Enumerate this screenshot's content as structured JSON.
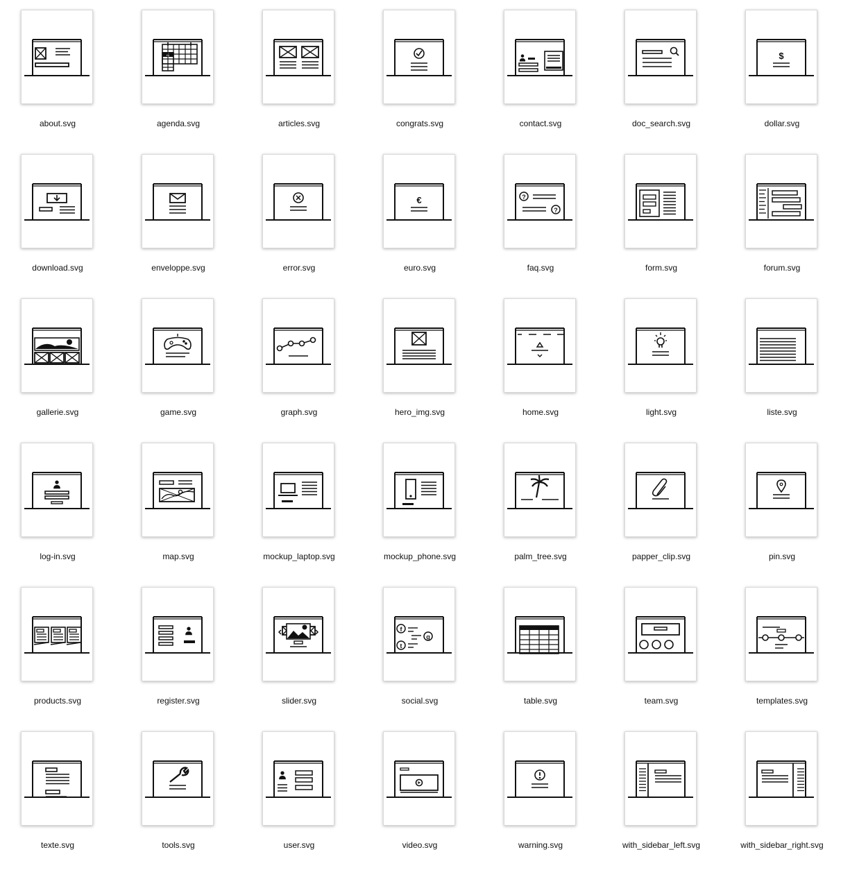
{
  "files": [
    {
      "name": "about.svg",
      "icon": "about-icon"
    },
    {
      "name": "agenda.svg",
      "icon": "agenda-icon"
    },
    {
      "name": "articles.svg",
      "icon": "articles-icon"
    },
    {
      "name": "congrats.svg",
      "icon": "congrats-icon"
    },
    {
      "name": "contact.svg",
      "icon": "contact-icon"
    },
    {
      "name": "doc_search.svg",
      "icon": "doc-search-icon"
    },
    {
      "name": "dollar.svg",
      "icon": "dollar-icon"
    },
    {
      "name": "download.svg",
      "icon": "download-icon"
    },
    {
      "name": "enveloppe.svg",
      "icon": "envelope-icon"
    },
    {
      "name": "error.svg",
      "icon": "error-icon"
    },
    {
      "name": "euro.svg",
      "icon": "euro-icon"
    },
    {
      "name": "faq.svg",
      "icon": "faq-icon"
    },
    {
      "name": "form.svg",
      "icon": "form-icon"
    },
    {
      "name": "forum.svg",
      "icon": "forum-icon"
    },
    {
      "name": "gallerie.svg",
      "icon": "gallery-icon"
    },
    {
      "name": "game.svg",
      "icon": "gamepad-icon"
    },
    {
      "name": "graph.svg",
      "icon": "graph-icon"
    },
    {
      "name": "hero_img.svg",
      "icon": "hero-image-icon"
    },
    {
      "name": "home.svg",
      "icon": "home-icon"
    },
    {
      "name": "light.svg",
      "icon": "lightbulb-icon"
    },
    {
      "name": "liste.svg",
      "icon": "list-icon"
    },
    {
      "name": "log-in.svg",
      "icon": "login-icon"
    },
    {
      "name": "map.svg",
      "icon": "map-icon"
    },
    {
      "name": "mockup_laptop.svg",
      "icon": "laptop-mockup-icon"
    },
    {
      "name": "mockup_phone.svg",
      "icon": "phone-mockup-icon"
    },
    {
      "name": "palm_tree.svg",
      "icon": "palm-tree-icon"
    },
    {
      "name": "papper_clip.svg",
      "icon": "paper-clip-icon"
    },
    {
      "name": "pin.svg",
      "icon": "pin-icon"
    },
    {
      "name": "products.svg",
      "icon": "products-icon"
    },
    {
      "name": "register.svg",
      "icon": "register-icon"
    },
    {
      "name": "slider.svg",
      "icon": "slider-icon"
    },
    {
      "name": "social.svg",
      "icon": "social-icon"
    },
    {
      "name": "table.svg",
      "icon": "table-icon"
    },
    {
      "name": "team.svg",
      "icon": "team-icon"
    },
    {
      "name": "templates.svg",
      "icon": "templates-icon"
    },
    {
      "name": "texte.svg",
      "icon": "text-icon"
    },
    {
      "name": "tools.svg",
      "icon": "wrench-icon"
    },
    {
      "name": "user.svg",
      "icon": "user-icon"
    },
    {
      "name": "video.svg",
      "icon": "video-icon"
    },
    {
      "name": "warning.svg",
      "icon": "warning-icon"
    },
    {
      "name": "with_sidebar_left.svg",
      "icon": "sidebar-left-icon"
    },
    {
      "name": "with_sidebar_right.svg",
      "icon": "sidebar-right-icon"
    }
  ],
  "glyphs": {
    "agenda_day": "4",
    "dollar": "$",
    "euro": "€",
    "faq": "?",
    "facebook": "f",
    "twitter": "t",
    "google": "g"
  }
}
